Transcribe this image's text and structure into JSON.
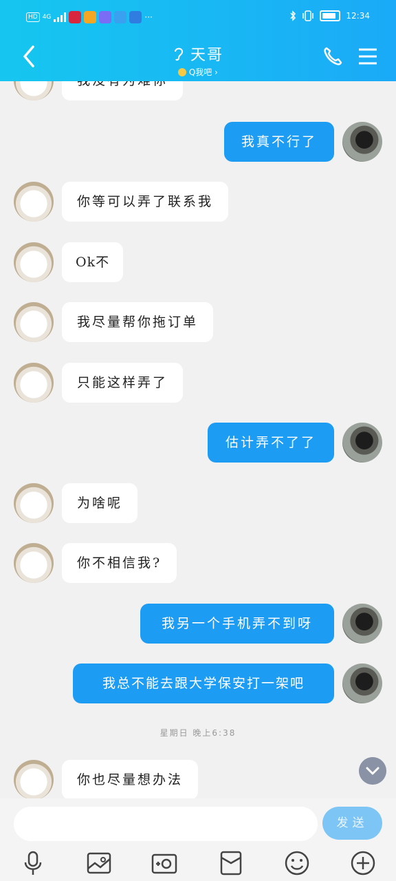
{
  "status_bar": {
    "network": "HD",
    "signal_label": "4G",
    "more": "···",
    "time": "12:34"
  },
  "header": {
    "title": "天哥",
    "subtitle": "Q我吧"
  },
  "messages": [
    {
      "side": "in",
      "text": "我没有为难你"
    },
    {
      "side": "out",
      "text": "我真不行了"
    },
    {
      "side": "in",
      "text": "你等可以弄了联系我"
    },
    {
      "side": "in",
      "text": "Ok不"
    },
    {
      "side": "in",
      "text": "我尽量帮你拖订单"
    },
    {
      "side": "in",
      "text": "只能这样弄了"
    },
    {
      "side": "out",
      "text": "估计弄不了了"
    },
    {
      "side": "in",
      "text": "为啥呢"
    },
    {
      "side": "in",
      "text": "你不相信我?"
    },
    {
      "side": "out",
      "text": "我另一个手机弄不到呀"
    },
    {
      "side": "out",
      "text": "我总不能去跟大学保安打一架吧"
    },
    {
      "side": "in",
      "text": "你也尽量想办法"
    }
  ],
  "timestamp": "星期日 晚上6:38",
  "input": {
    "placeholder": "",
    "send_label": "发送"
  },
  "toolbar": [
    "mic-icon",
    "image-icon",
    "camera-icon",
    "red-packet-icon",
    "emoji-icon",
    "plus-icon"
  ],
  "colors": {
    "header": "#19b6f4",
    "out_bubble": "#1d9cf3",
    "send": "#7cc5f5"
  }
}
